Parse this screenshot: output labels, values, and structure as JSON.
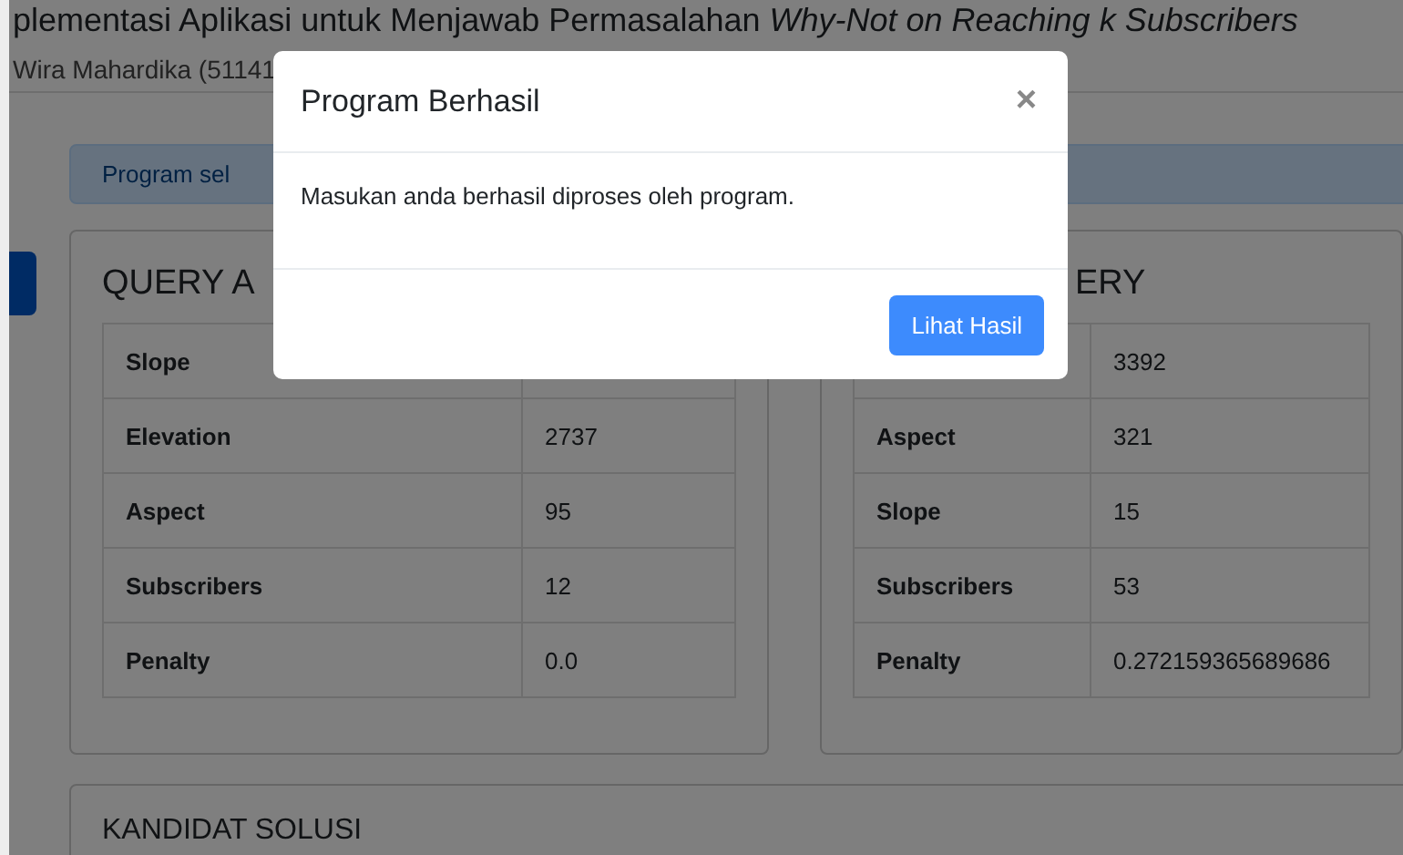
{
  "header": {
    "title": "plementasi Aplikasi untuk Menjawab Permasalahan",
    "title_italic": "Why-Not on Reaching k Subscribers",
    "subtitle": "Wira Mahardika (51141"
  },
  "alert": {
    "text": "Program sel"
  },
  "cards": [
    {
      "title": "QUERY A",
      "rows": [
        {
          "label": "Slope",
          "value": ""
        },
        {
          "label": "Elevation",
          "value": "2737"
        },
        {
          "label": "Aspect",
          "value": "95"
        },
        {
          "label": "Subscribers",
          "value": "12"
        },
        {
          "label": "Penalty",
          "value": "0.0"
        }
      ]
    },
    {
      "title": "ERY",
      "rows": [
        {
          "label": "",
          "value": "3392"
        },
        {
          "label": "Aspect",
          "value": "321"
        },
        {
          "label": "Slope",
          "value": "15"
        },
        {
          "label": "Subscribers",
          "value": "53"
        },
        {
          "label": "Penalty",
          "value": "0.272159365689686"
        }
      ]
    }
  ],
  "bottom_card": {
    "title": "KANDIDAT SOLUSI"
  },
  "modal": {
    "title": "Program Berhasil",
    "close": "×",
    "body": "Masukan anda berhasil diproses oleh program.",
    "button": "Lihat Hasil"
  }
}
